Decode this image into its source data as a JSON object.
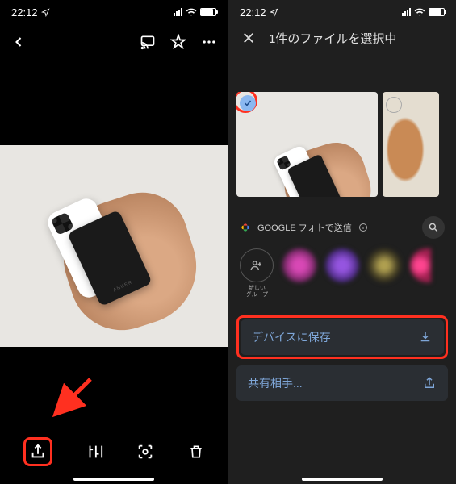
{
  "status": {
    "time": "22:12"
  },
  "left": {
    "photo_label": "ANKER"
  },
  "right": {
    "header": {
      "title": "1件のファイルを選択中"
    },
    "google_row": {
      "label": "GOOGLE フォトで送信"
    },
    "new_group_label": "新しい\nグループ",
    "options": {
      "save": "デバイスに保存",
      "share": "共有相手..."
    }
  }
}
